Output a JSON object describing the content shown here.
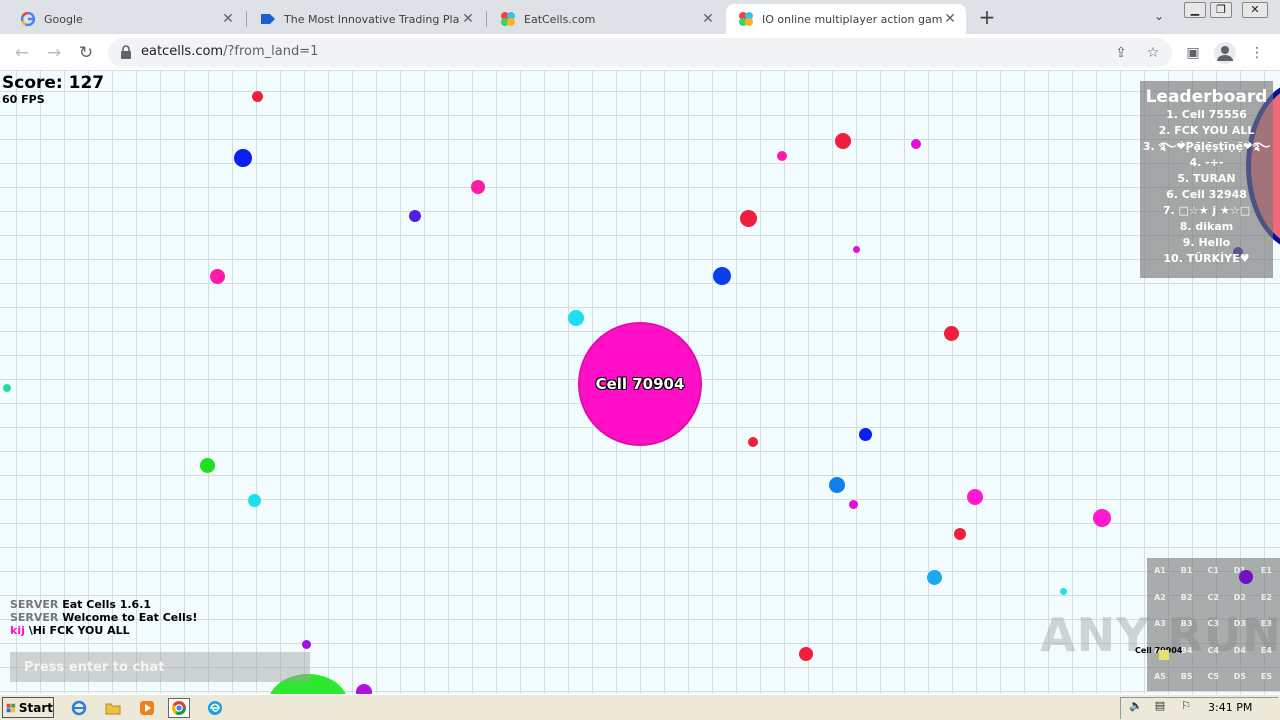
{
  "browser": {
    "tabs": [
      {
        "title": "Google",
        "active": false
      },
      {
        "title": "The Most Innovative Trading Platform",
        "active": false
      },
      {
        "title": "EatCells.com",
        "active": false
      },
      {
        "title": "IO online multiplayer action game. Sk",
        "active": true
      }
    ],
    "new_tab": "+",
    "url_host": "eatcells.com",
    "url_path": "/?from_land=1"
  },
  "game": {
    "score": "Score: 127",
    "fps": "60 FPS",
    "player_name": "Cell 70904",
    "leaderboard": {
      "title": "Leaderboard",
      "entries": [
        "1. Cell 75556",
        "2. FCK YOU ALL",
        "3. ࿐❤̀P̣ạ̄ḷẹ̄ṣṭīṇẹ̄❤̀࿐",
        "4. -+-",
        "5. TURAN",
        "6. Cell 32948",
        "7. □☆★ j ★☆□",
        "8. dikam",
        "9. Hello",
        "10. TÜRKİYE♥"
      ]
    },
    "chat": [
      {
        "who": "SERVER",
        "msg": "Eat Cells 1.6.1"
      },
      {
        "who": "SERVER",
        "msg": "Welcome to Eat Cells!"
      },
      {
        "who": "kij",
        "msg": "\\Hi FCK YOU ALL"
      }
    ],
    "chat_placeholder": "Press enter to chat",
    "minimap": {
      "cells": [
        "A1",
        "B1",
        "C1",
        "D1",
        "E1",
        "A2",
        "B2",
        "C2",
        "D2",
        "E2",
        "A3",
        "B3",
        "C3",
        "D3",
        "E3",
        "A4",
        "B4",
        "C4",
        "D4",
        "E4",
        "A5",
        "B5",
        "C5",
        "D5",
        "E5"
      ],
      "player_label": "Cell 70904"
    },
    "watermark": "ANY RUN"
  },
  "taskbar": {
    "start_label": "Start",
    "clock": "3:41 PM"
  }
}
